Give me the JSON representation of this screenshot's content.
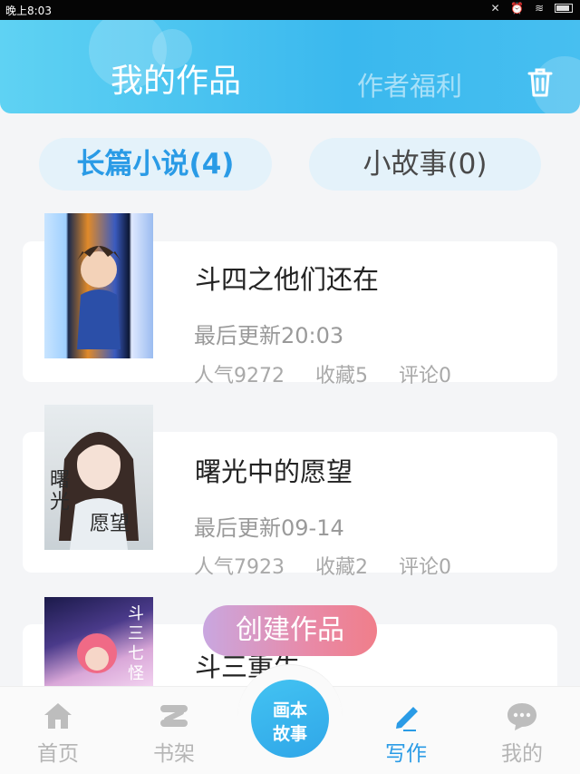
{
  "status_bar": {
    "time": "晚上8:03"
  },
  "header": {
    "title": "我的作品",
    "welfare": "作者福利"
  },
  "tabs": [
    {
      "label": "长篇小说(4)",
      "active": true
    },
    {
      "label": "小故事(0)",
      "active": false
    }
  ],
  "works": [
    {
      "title": "斗四之他们还在",
      "updated": "最后更新20:03",
      "popularity": "人气9272",
      "favorites": "收藏5",
      "comments": "评论0"
    },
    {
      "title": "曙光中的愿望",
      "updated": "最后更新09-14",
      "popularity": "人气7923",
      "favorites": "收藏2",
      "comments": "评论0"
    },
    {
      "title": "斗三重生"
    }
  ],
  "create_button": "创建作品",
  "bottom_nav": [
    {
      "label": "首页",
      "icon": "home-icon"
    },
    {
      "label": "书架",
      "icon": "bookshelf-icon"
    },
    {
      "label": "画本故事",
      "icon": "comic-story-button"
    },
    {
      "label": "写作",
      "icon": "pen-icon",
      "active": true
    },
    {
      "label": "我的",
      "icon": "chat-bubble-icon"
    }
  ],
  "center_button": {
    "line1": "画本",
    "line2": "故事"
  },
  "colors": {
    "accent": "#2a9be6",
    "header_start": "#5fd2f3",
    "header_end": "#3ab8ee",
    "create_start": "#c9a7e0",
    "create_end": "#f07e8a"
  }
}
